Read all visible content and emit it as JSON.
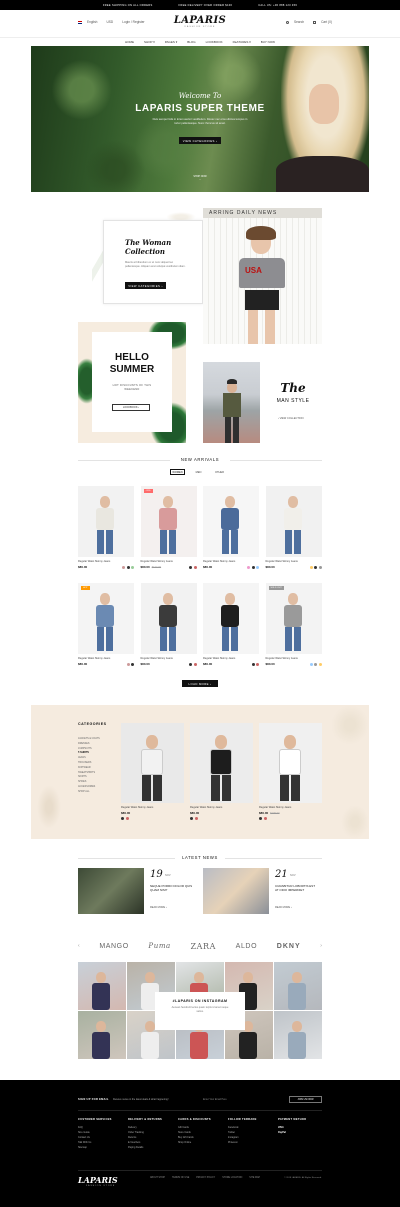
{
  "topbar": {
    "items": [
      "Free shipping on all orders",
      "Free delivery over order $100",
      "Call us: +00 888 123 456"
    ]
  },
  "header": {
    "lang": "English",
    "currency": "USD",
    "login": "Login / Register",
    "logo": "LAPARIS",
    "tagline": "Fashion Store",
    "search": "Search",
    "cart": "Cart (0)"
  },
  "nav": [
    "Home",
    "Shop",
    "Pages",
    "Blog",
    "Lookbook",
    "Features",
    "Buy Now"
  ],
  "hero": {
    "welcome": "Welcome To",
    "title": "LAPARIS SUPER THEME",
    "text": "Duis semper felis in lorem auctor vestibulum. Donec nec eros ultrices tempus in tortor pellentesque. Nunc rhoncus sit amet.",
    "button": "View Categories",
    "scroll": "Shop Now"
  },
  "woman": {
    "title": "The Woman Collection",
    "text": "Mauris at bibendum ex et nunc aliquet leo pellentesque. Aliquam erat volutpat vestibulum diam.",
    "button": "View Categories"
  },
  "summer": {
    "title": "HELLO SUMMER",
    "text": "Hot discounts of this weekend",
    "button": "Lookbook"
  },
  "man": {
    "the": "The",
    "style": "MAN STYLE",
    "link": "View Collection"
  },
  "arrivals": {
    "title": "NEW ARRIVALS",
    "tabs": [
      "Women",
      "Men",
      "Other"
    ],
    "products": [
      {
        "name": "Regular Waist Skinny Jeans",
        "price": "$80.00",
        "old": "",
        "badge": ""
      },
      {
        "name": "Regular Waist Skinny Jeans",
        "price": "$80.00",
        "old": "$100.00",
        "badge": "-20%"
      },
      {
        "name": "Regular Waist Skinny Jeans",
        "price": "$80.00",
        "old": "",
        "badge": ""
      },
      {
        "name": "Regular Waist Skinny Jeans",
        "price": "$80.00",
        "old": "",
        "badge": ""
      },
      {
        "name": "Regular Waist Skinny Jeans",
        "price": "$80.00",
        "old": "",
        "badge": "Hot"
      },
      {
        "name": "Regular Waist Skinny Jeans",
        "price": "$80.00",
        "old": "",
        "badge": ""
      },
      {
        "name": "Regular Waist Skinny Jeans",
        "price": "$80.00",
        "old": "",
        "badge": ""
      },
      {
        "name": "Regular Waist Skinny Jeans",
        "price": "$80.00",
        "old": "",
        "badge": "Sold Out"
      }
    ],
    "load_more": "Load More"
  },
  "categories": {
    "title": "CATEGORIES",
    "items": [
      "Jackets & Coats",
      "Dresses",
      "Jumpsuits",
      "T-Shirts",
      "Jeans",
      "Trousers",
      "Knitwear",
      "Sweatshirts",
      "Skirts",
      "Shoes",
      "Accessories",
      "Shop All"
    ],
    "products": [
      {
        "name": "Regular Waist Skinny Jeans",
        "price": "$80.00",
        "old": ""
      },
      {
        "name": "Regular Waist Skinny Jeans",
        "price": "$80.00",
        "old": ""
      },
      {
        "name": "Regular Waist Skinny Jeans",
        "price": "$80.00",
        "old": "$100.00"
      }
    ]
  },
  "news": {
    "title": "LATEST NEWS",
    "posts": [
      {
        "day": "19",
        "month": "Nov",
        "title": "Neque porro dolor quis quam nisi?",
        "more": "Read More"
      },
      {
        "day": "21",
        "month": "Nov",
        "title": "Curabitur lobortis est at odio imperdiet",
        "more": "Read More"
      }
    ]
  },
  "brands": [
    "MANGO",
    "Puma",
    "ZARA",
    "ALDO",
    "DKNY"
  ],
  "instagram": {
    "title": "#LAPARIS ON INSTAGRAM",
    "text": "Aenean hendrerit lectus quam turpis id amet neque varius."
  },
  "footer": {
    "signup": "Sign up for Email",
    "signup_text": "Receive news on the latest deals & what happening!",
    "placeholder": "Enter Your Email Here",
    "join": "Join Us Now",
    "cols": [
      {
        "title": "Customer Services",
        "items": [
          "FAQ",
          "Size Guide",
          "Contact Us",
          "Talk With Us",
          "Sitemap"
        ]
      },
      {
        "title": "Delivery & Returns",
        "items": [
          "Delivery",
          "Order Tracking",
          "Returns",
          "E-Vouchers",
          "Paying Details"
        ]
      },
      {
        "title": "Cards & Discounts",
        "items": [
          "Gift Cards",
          "Store Cards",
          "Buy Gift Cards",
          "Shop Online"
        ]
      },
      {
        "title": "Follow Terrade",
        "items": [
          "Facebook",
          "Twitter",
          "Instagram",
          "Pinterest"
        ]
      },
      {
        "title": "Payment Method",
        "items": [
          "VISA",
          "PayPal"
        ]
      }
    ],
    "links": [
      "About Shop",
      "Terms of Use",
      "Privacy Policy",
      "Store Location",
      "Site Map"
    ],
    "copyright": "© 2018 LAPARIS. All Rights Reserved.",
    "logo": "LAPARIS",
    "tagline": "Fashion Store"
  },
  "colors": {
    "accent": "#ff6b6b",
    "cream": "#f5ebdf"
  }
}
